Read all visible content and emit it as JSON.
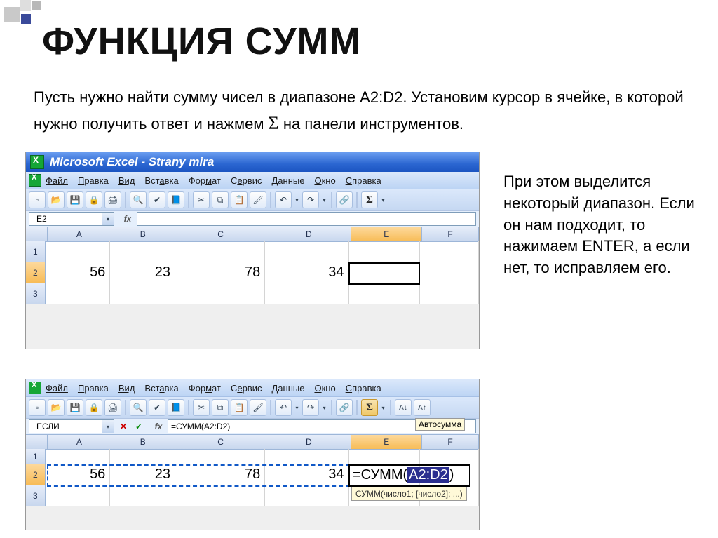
{
  "title": "ФУНКЦИЯ СУММ",
  "intro_part1": "Пусть нужно найти сумму чисел в диапазоне A2:D2. Установим курсор в ячейке, в которой нужно получить ответ и нажмем ",
  "intro_sigma": "Σ",
  "intro_part2": " на панели инструментов.",
  "side_note": "При этом выделится некоторый диапазон. Если он нам подходит, то нажимаем ENTER, а если нет, то исправляем его.",
  "excel": {
    "window_title": "Microsoft Excel - Strany mira",
    "menus": [
      "Файл",
      "Правка",
      "Вид",
      "Вставка",
      "Формат",
      "Сервис",
      "Данные",
      "Окно",
      "Справка"
    ],
    "name_box_top": "E2",
    "name_box_bottom": "ЕСЛИ",
    "formula_top": "",
    "formula_bottom": "=СУММ(A2:D2)",
    "fx_label": "fx",
    "tooltip_autosum": "Автосумма",
    "sumtip": "СУММ(число1; [число2]; ...)",
    "columns": [
      "A",
      "B",
      "C",
      "D",
      "E",
      "F"
    ],
    "rows": [
      "1",
      "2",
      "3"
    ],
    "data_row2": {
      "A": "56",
      "B": "23",
      "C": "78",
      "D": "34"
    },
    "sum_overlay_prefix": "=СУММ(",
    "sum_overlay_range": "A2:D2",
    "sum_overlay_suffix": ")"
  }
}
